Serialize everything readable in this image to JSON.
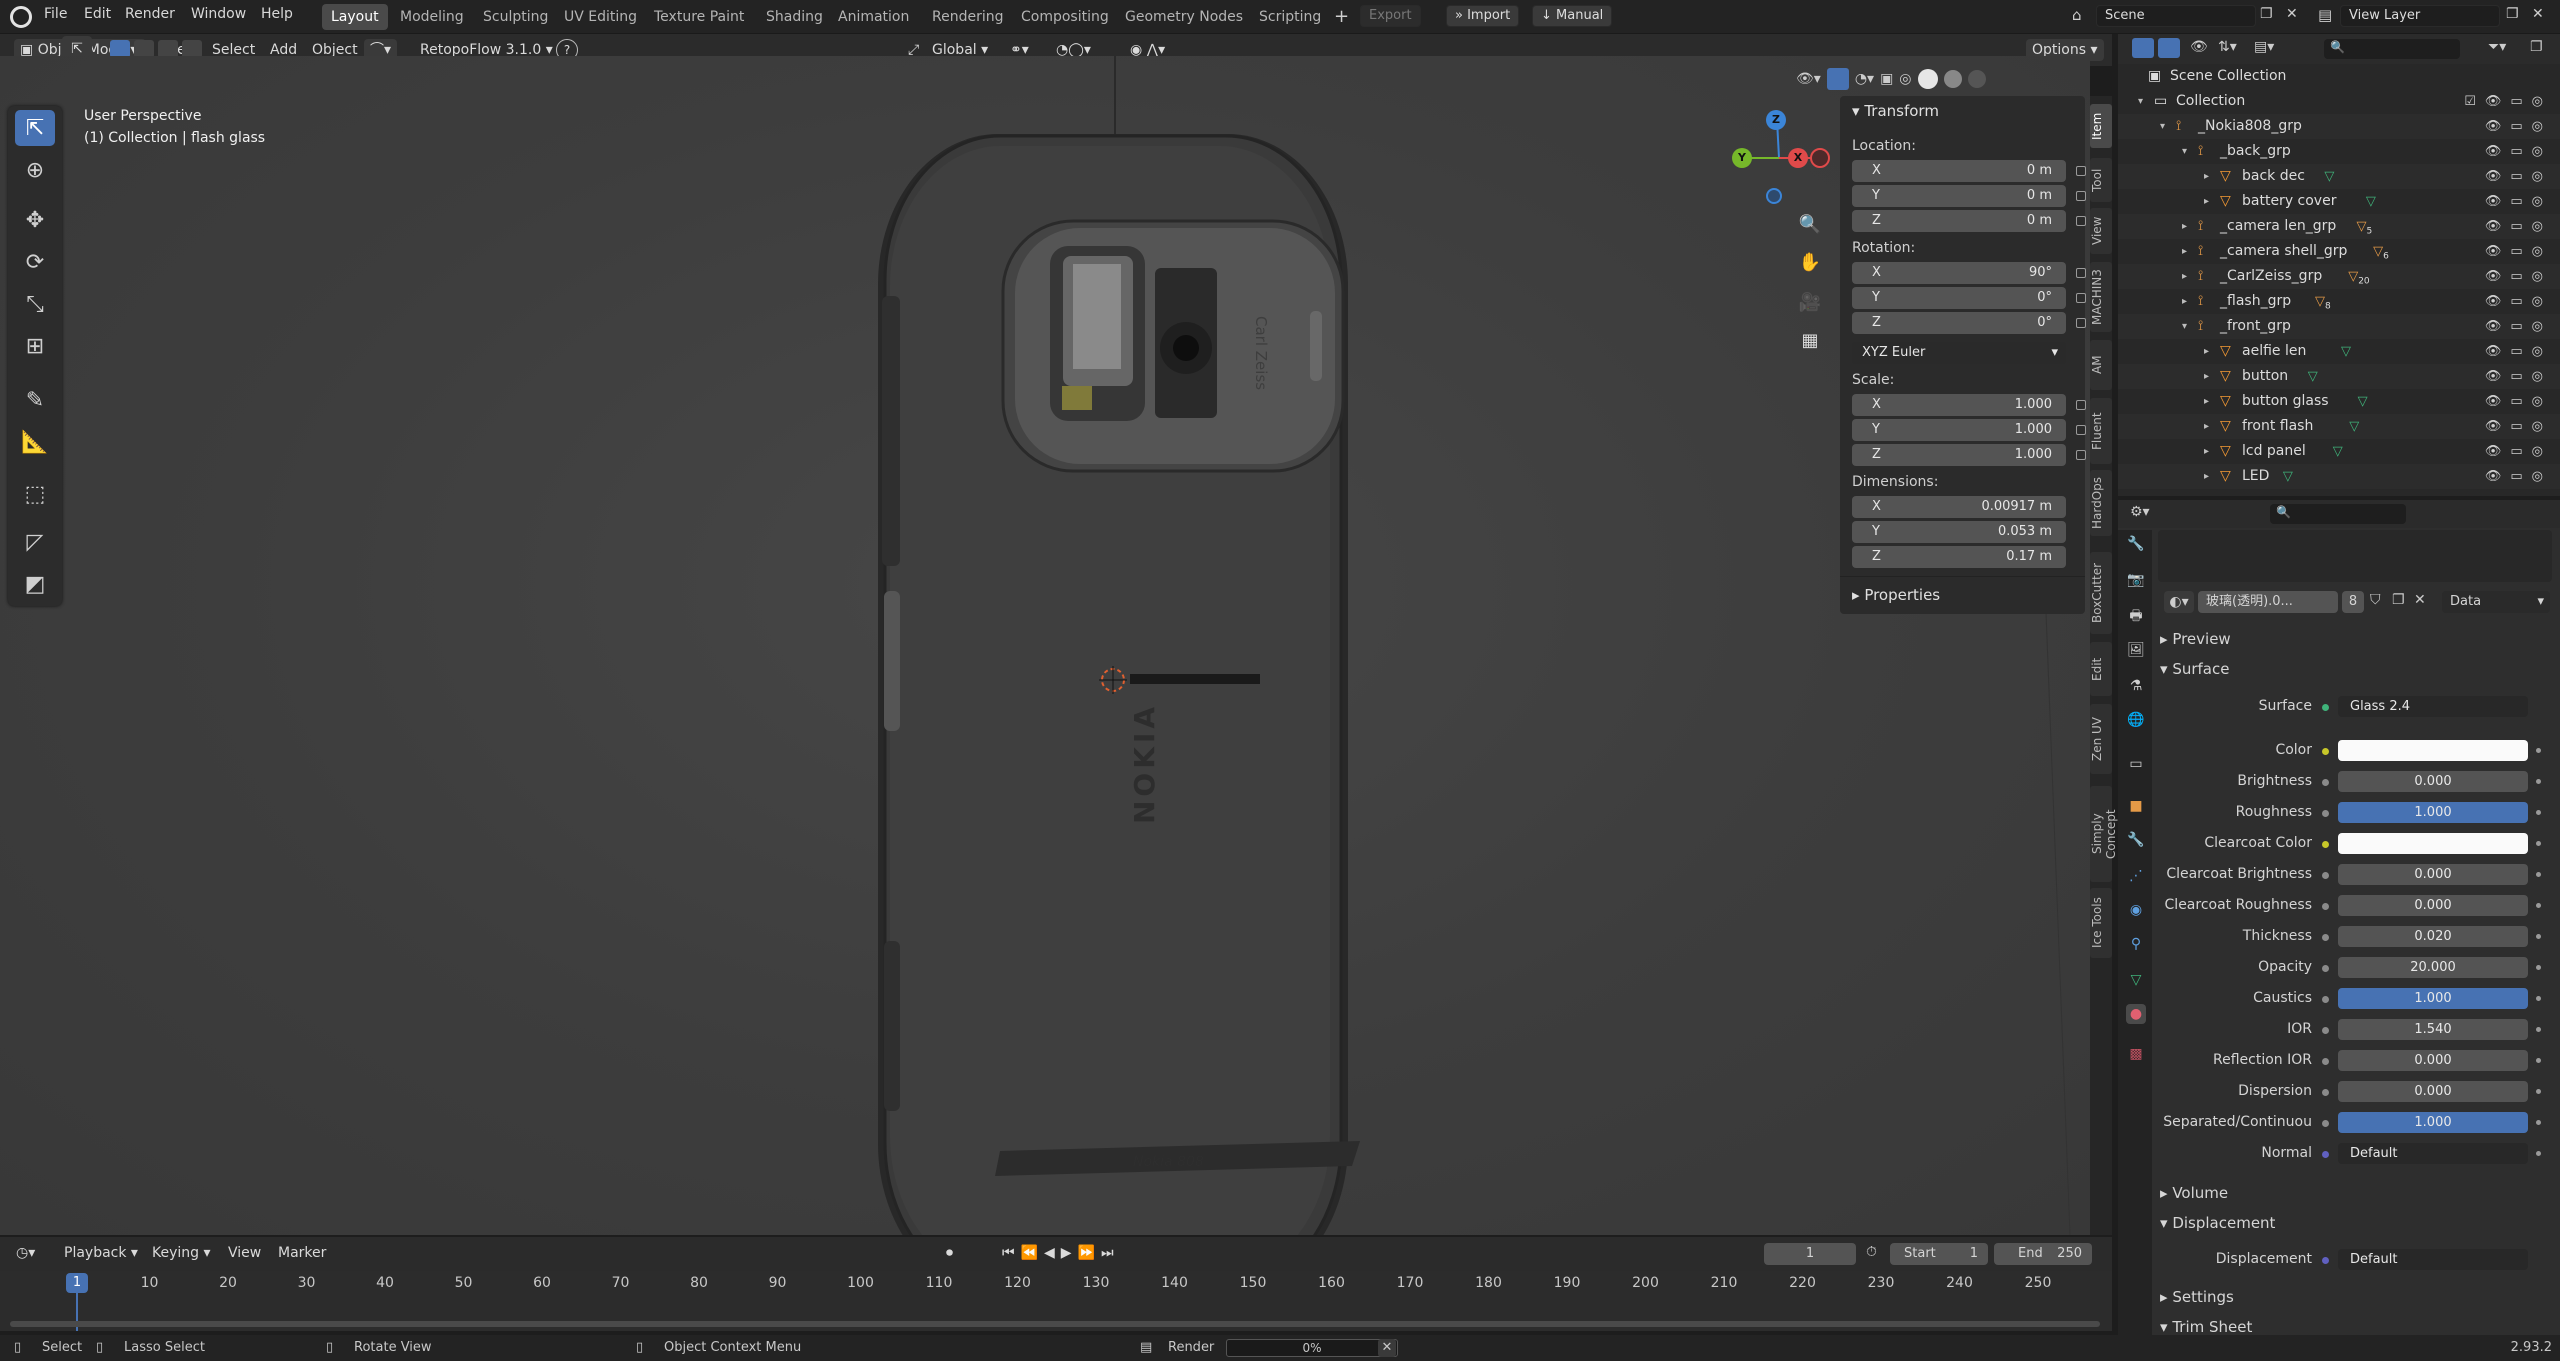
{
  "menu": {
    "file": "File",
    "edit": "Edit",
    "render": "Render",
    "window": "Window",
    "help": "Help"
  },
  "workspaces": [
    "Layout",
    "Modeling",
    "Sculpting",
    "UV Editing",
    "Texture Paint",
    "Shading",
    "Animation",
    "Rendering",
    "Compositing",
    "Geometry Nodes",
    "Scripting"
  ],
  "topright": {
    "export": "Export",
    "import": "Import",
    "manual": "Manual",
    "scene": "Scene",
    "view_layer": "View Layer"
  },
  "viewport_header": {
    "mode": "Object Mode",
    "view": "View",
    "select": "Select",
    "add": "Add",
    "object": "Object",
    "addon": "RetopoFlow 3.1.0",
    "help": "?",
    "orientation": "Global",
    "options": "Options"
  },
  "viewport": {
    "perspective": "User Perspective",
    "collection": "(1) Collection | flash glass",
    "brand": "NOKIA",
    "carl_zeiss": "Carl Zeiss",
    "model": "Nokia 808"
  },
  "gizmo": {
    "x": "X",
    "y": "Y",
    "z": "Z"
  },
  "transform": {
    "title": "Transform",
    "location_label": "Location:",
    "location": [
      {
        "axis": "X",
        "value": "0 m"
      },
      {
        "axis": "Y",
        "value": "0 m"
      },
      {
        "axis": "Z",
        "value": "0 m"
      }
    ],
    "rotation_label": "Rotation:",
    "rotation": [
      {
        "axis": "X",
        "value": "90°"
      },
      {
        "axis": "Y",
        "value": "0°"
      },
      {
        "axis": "Z",
        "value": "0°"
      }
    ],
    "rotation_mode": "XYZ Euler",
    "scale_label": "Scale:",
    "scale": [
      {
        "axis": "X",
        "value": "1.000"
      },
      {
        "axis": "Y",
        "value": "1.000"
      },
      {
        "axis": "Z",
        "value": "1.000"
      }
    ],
    "dimensions_label": "Dimensions:",
    "dimensions": [
      {
        "axis": "X",
        "value": "0.00917 m"
      },
      {
        "axis": "Y",
        "value": "0.053 m"
      },
      {
        "axis": "Z",
        "value": "0.17 m"
      }
    ],
    "properties": "Properties"
  },
  "side_tabs": [
    "Item",
    "Tool",
    "View",
    "MACHIN3",
    "AM",
    "Fluent",
    "HardOps",
    "BoxCutter",
    "Edit",
    "Zen UV",
    "Simply Concept",
    "Ice Tools"
  ],
  "outliner": {
    "scene_collection": "Scene Collection",
    "rows": [
      {
        "label": "Collection",
        "indent": 0,
        "type": "collection"
      },
      {
        "label": "_Nokia808_grp",
        "indent": 1,
        "type": "group"
      },
      {
        "label": "_back_grp",
        "indent": 2,
        "type": "group"
      },
      {
        "label": "back dec",
        "indent": 3,
        "type": "mesh"
      },
      {
        "label": "battery cover",
        "indent": 3,
        "type": "mesh"
      },
      {
        "label": "_camera len_grp",
        "indent": 2,
        "type": "group",
        "count": "5"
      },
      {
        "label": "_camera shell_grp",
        "indent": 2,
        "type": "group",
        "count": "6"
      },
      {
        "label": "_CarlZeiss_grp",
        "indent": 2,
        "type": "group",
        "count": "20"
      },
      {
        "label": "_flash_grp",
        "indent": 2,
        "type": "group",
        "count": "8"
      },
      {
        "label": "_front_grp",
        "indent": 2,
        "type": "group"
      },
      {
        "label": "aelfie len",
        "indent": 3,
        "type": "mesh"
      },
      {
        "label": "button",
        "indent": 3,
        "type": "mesh"
      },
      {
        "label": "button glass",
        "indent": 3,
        "type": "mesh"
      },
      {
        "label": "front flash",
        "indent": 3,
        "type": "mesh"
      },
      {
        "label": "lcd panel",
        "indent": 3,
        "type": "mesh"
      },
      {
        "label": "LED",
        "indent": 3,
        "type": "mesh"
      }
    ]
  },
  "material": {
    "name": "玻璃(透明).0...",
    "users": "8",
    "link": "Data",
    "sections": {
      "preview": "Preview",
      "surface": "Surface",
      "volume": "Volume",
      "displacement": "Displacement",
      "settings": "Settings",
      "trim": "Trim Sheet"
    },
    "surface_label": "Surface",
    "surface_value": "Glass 2.4",
    "inputs": [
      {
        "label": "Color",
        "value": "",
        "style": "white"
      },
      {
        "label": "Brightness",
        "value": "0.000",
        "style": "grey"
      },
      {
        "label": "Roughness",
        "value": "1.000",
        "style": "blue"
      },
      {
        "label": "Clearcoat Color",
        "value": "",
        "style": "white"
      },
      {
        "label": "Clearcoat Brightness",
        "value": "0.000",
        "style": "grey"
      },
      {
        "label": "Clearcoat Roughness",
        "value": "0.000",
        "style": "grey"
      },
      {
        "label": "Thickness",
        "value": "0.020",
        "style": "grey"
      },
      {
        "label": "Opacity",
        "value": "20.000",
        "style": "grey"
      },
      {
        "label": "Caustics",
        "value": "1.000",
        "style": "blue"
      },
      {
        "label": "IOR",
        "value": "1.540",
        "style": "grey"
      },
      {
        "label": "Reflection IOR",
        "value": "0.000",
        "style": "grey"
      },
      {
        "label": "Dispersion",
        "value": "0.000",
        "style": "grey"
      },
      {
        "label": "Separated/Continuou",
        "value": "1.000",
        "style": "blue"
      },
      {
        "label": "Normal",
        "value": "Default",
        "style": "dark"
      }
    ],
    "displacement_label": "Displacement",
    "displacement_value": "Default"
  },
  "timeline": {
    "playback": "Playback",
    "keying": "Keying",
    "view": "View",
    "marker": "Marker",
    "current_frame": "1",
    "start_label": "Start",
    "start": "1",
    "end_label": "End",
    "end": "250",
    "ticks": [
      "1",
      "10",
      "20",
      "30",
      "40",
      "50",
      "60",
      "70",
      "80",
      "90",
      "100",
      "110",
      "120",
      "130",
      "140",
      "150",
      "160",
      "170",
      "180",
      "190",
      "200",
      "210",
      "220",
      "230",
      "240",
      "250"
    ]
  },
  "status": {
    "select": "Select",
    "lasso": "Lasso Select",
    "rotate": "Rotate View",
    "context": "Object Context Menu",
    "render": "Render",
    "progress": "0%",
    "version": "2.93.2"
  },
  "colors": {
    "accent": "#4772b3",
    "gizmo_x": "#e04a4a",
    "gizmo_y": "#76b82a",
    "gizmo_z": "#3b85d8"
  }
}
